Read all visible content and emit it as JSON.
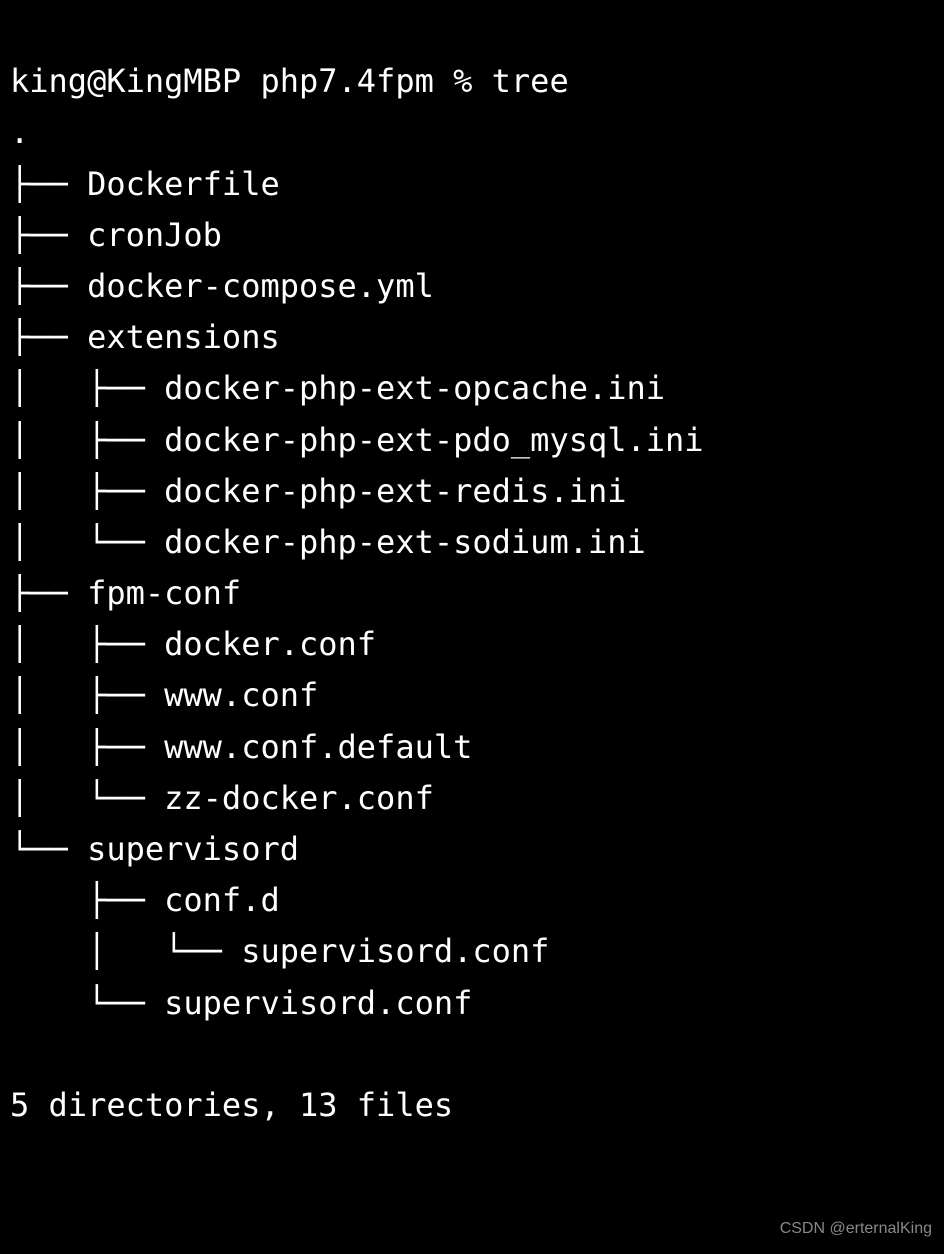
{
  "prompt": {
    "user": "king",
    "host": "KingMBP",
    "cwd": "php7.4fpm",
    "symbol": "%",
    "command": "tree"
  },
  "tree": {
    "root": ".",
    "lines": [
      "├── Dockerfile",
      "├── cronJob",
      "├── docker-compose.yml",
      "├── extensions",
      "│   ├── docker-php-ext-opcache.ini",
      "│   ├── docker-php-ext-pdo_mysql.ini",
      "│   ├── docker-php-ext-redis.ini",
      "│   └── docker-php-ext-sodium.ini",
      "├── fpm-conf",
      "│   ├── docker.conf",
      "│   ├── www.conf",
      "│   ├── www.conf.default",
      "│   └── zz-docker.conf",
      "└── supervisord",
      "    ├── conf.d",
      "    │   └── supervisord.conf",
      "    └── supervisord.conf"
    ]
  },
  "summary": "5 directories, 13 files",
  "watermark": "CSDN @erternalKing"
}
